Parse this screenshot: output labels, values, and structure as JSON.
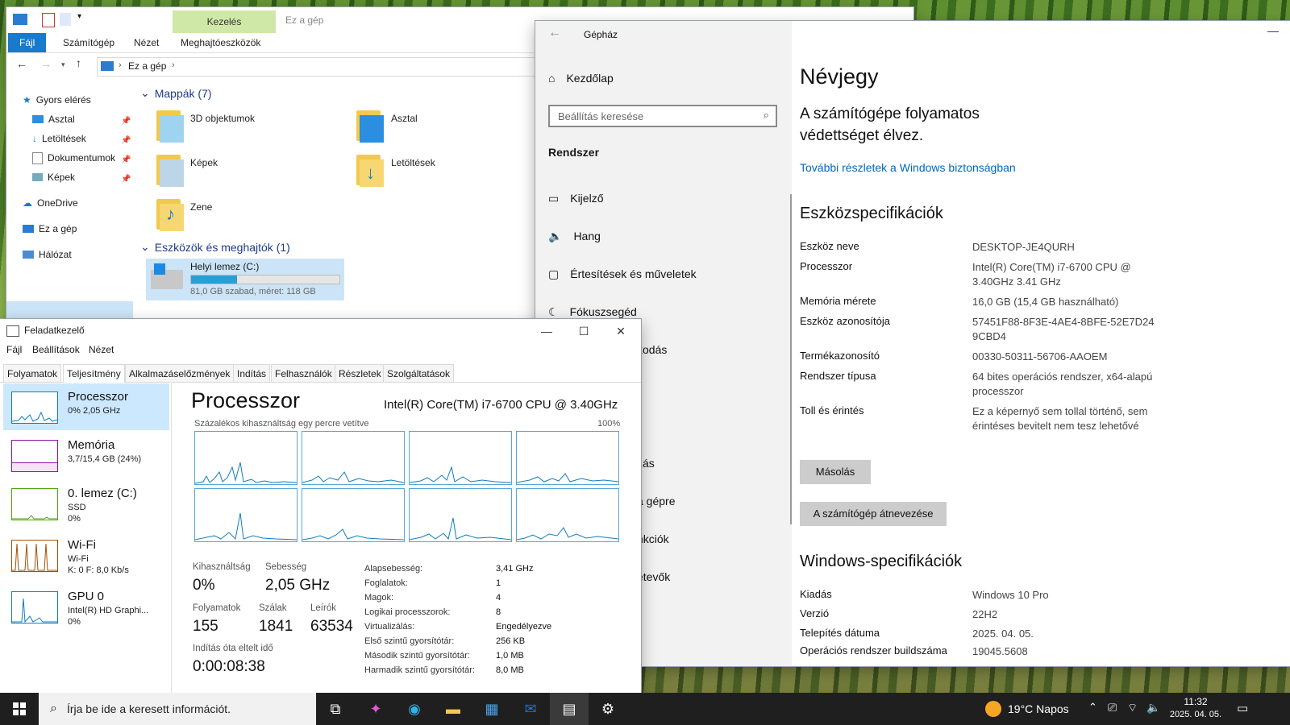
{
  "explorer": {
    "qat_location": "Ez a gép",
    "ribbon": {
      "file": "Fájl",
      "computer": "Számítógép",
      "view": "Nézet",
      "manage_group": "Kezelés",
      "drive_tools": "Meghajtóeszközök"
    },
    "breadcrumb": "Ez a gép",
    "nav": [
      {
        "label": "Gyors elérés"
      },
      {
        "label": "Asztal"
      },
      {
        "label": "Letöltések"
      },
      {
        "label": "Dokumentumok"
      },
      {
        "label": "Képek"
      },
      {
        "label": "OneDrive"
      },
      {
        "label": "Ez a gép"
      },
      {
        "label": "Hálózat"
      }
    ],
    "folders_group": "Mappák (7)",
    "folders": [
      "3D objektumok",
      "Asztal",
      "Képek",
      "Letöltések",
      "Zene"
    ],
    "devices_group": "Eszközök és meghajtók (1)",
    "drive": {
      "name": "Helyi lemez (C:)",
      "info": "81,0 GB szabad, méret: 118 GB",
      "used_fraction": 0.31
    }
  },
  "settings": {
    "app_title": "Gépház",
    "home": "Kezdőlap",
    "search_placeholder": "Beállítás keresése",
    "section": "Rendszer",
    "nav": [
      {
        "label": "Kijelző"
      },
      {
        "label": "Hang"
      },
      {
        "label": "Értesítések és műveletek"
      },
      {
        "label": "Fókuszsegéd"
      },
      {
        "label": "kodás"
      },
      {
        "label": "zás"
      },
      {
        "label": "a gépre"
      },
      {
        "label": "nkciók"
      },
      {
        "label": "etevők"
      }
    ],
    "page_title": "Névjegy",
    "protection": "A számítógépe folyamatos védettséget élvez.",
    "security_link": "További részletek a Windows biztonságban",
    "device_specs_title": "Eszközspecifikációk",
    "device_specs": [
      {
        "k": "Eszköz neve",
        "v": "DESKTOP-JE4QURH"
      },
      {
        "k": "Processzor",
        "v": "Intel(R) Core(TM) i7-6700 CPU @ 3.40GHz   3.41 GHz"
      },
      {
        "k": "Memória mérete",
        "v": "16,0 GB (15,4 GB használható)"
      },
      {
        "k": "Eszköz azonosítója",
        "v": "57451F88-8F3E-4AE4-8BFE-52E7D24 9CBD4"
      },
      {
        "k": "Termékazonosító",
        "v": "00330-50311-56706-AAOEM"
      },
      {
        "k": "Rendszer típusa",
        "v": "64 bites operációs rendszer, x64-alapú processzor"
      },
      {
        "k": "Toll és érintés",
        "v": "Ez a képernyő sem tollal történő, sem érintéses bevitelt nem tesz lehetővé"
      }
    ],
    "copy_button": "Másolás",
    "rename_button": "A számítógép átnevezése",
    "windows_specs_title": "Windows-specifikációk",
    "windows_specs": [
      {
        "k": "Kiadás",
        "v": "Windows 10 Pro"
      },
      {
        "k": "Verzió",
        "v": "22H2"
      },
      {
        "k": "Telepítés dátuma",
        "v": "2025. 04. 05."
      },
      {
        "k": "Operációs rendszer buildszáma",
        "v": "19045.5608"
      }
    ]
  },
  "taskmgr": {
    "title": "Feladatkezelő",
    "menu": [
      "Fájl",
      "Beállítások",
      "Nézet"
    ],
    "tabs": [
      "Folyamatok",
      "Teljesítmény",
      "Alkalmazáselőzmények",
      "Indítás",
      "Felhasználók",
      "Részletek",
      "Szolgáltatások"
    ],
    "side": [
      {
        "name": "Processzor",
        "sub1": "0% 2,05 GHz",
        "sub2": ""
      },
      {
        "name": "Memória",
        "sub1": "3,7/15,4 GB (24%)",
        "sub2": ""
      },
      {
        "name": "0. lemez (C:)",
        "sub1": "SSD",
        "sub2": "0%"
      },
      {
        "name": "Wi-Fi",
        "sub1": "Wi-Fi",
        "sub2": "K: 0 F: 8,0 Kb/s"
      },
      {
        "name": "GPU 0",
        "sub1": "Intel(R) HD Graphi...",
        "sub2": "0%"
      }
    ],
    "heading": "Processzor",
    "cpu_model": "Intel(R) Core(TM) i7-6700 CPU @ 3.40GHz",
    "graph_caption": "Százalékos kihasználtság egy percre vetítve",
    "graph_max": "100%",
    "stats": {
      "util_label": "Kihasználtság",
      "util": "0%",
      "speed_label": "Sebesség",
      "speed": "2,05 GHz",
      "proc_label": "Folyamatok",
      "proc": "155",
      "threads_label": "Szálak",
      "threads": "1841",
      "handles_label": "Leírók",
      "handles": "63534",
      "uptime_label": "Indítás óta eltelt idő",
      "uptime": "0:00:08:38"
    },
    "details": [
      {
        "k": "Alapsebesség:",
        "v": "3,41 GHz"
      },
      {
        "k": "Foglalatok:",
        "v": "1"
      },
      {
        "k": "Magok:",
        "v": "4"
      },
      {
        "k": "Logikai processzorok:",
        "v": "8"
      },
      {
        "k": "Virtualizálás:",
        "v": "Engedélyezve"
      },
      {
        "k": "Első szintű gyorsítótár:",
        "v": "256 KB"
      },
      {
        "k": "Második szintű gyorsítótár:",
        "v": "1,0 MB"
      },
      {
        "k": "Harmadik szintű gyorsítótár:",
        "v": "8,0 MB"
      }
    ]
  },
  "taskbar": {
    "search_placeholder": "Írja be ide a keresett információt.",
    "weather": "19°C  Napos",
    "time": "11:32",
    "date": "2025. 04. 05."
  }
}
